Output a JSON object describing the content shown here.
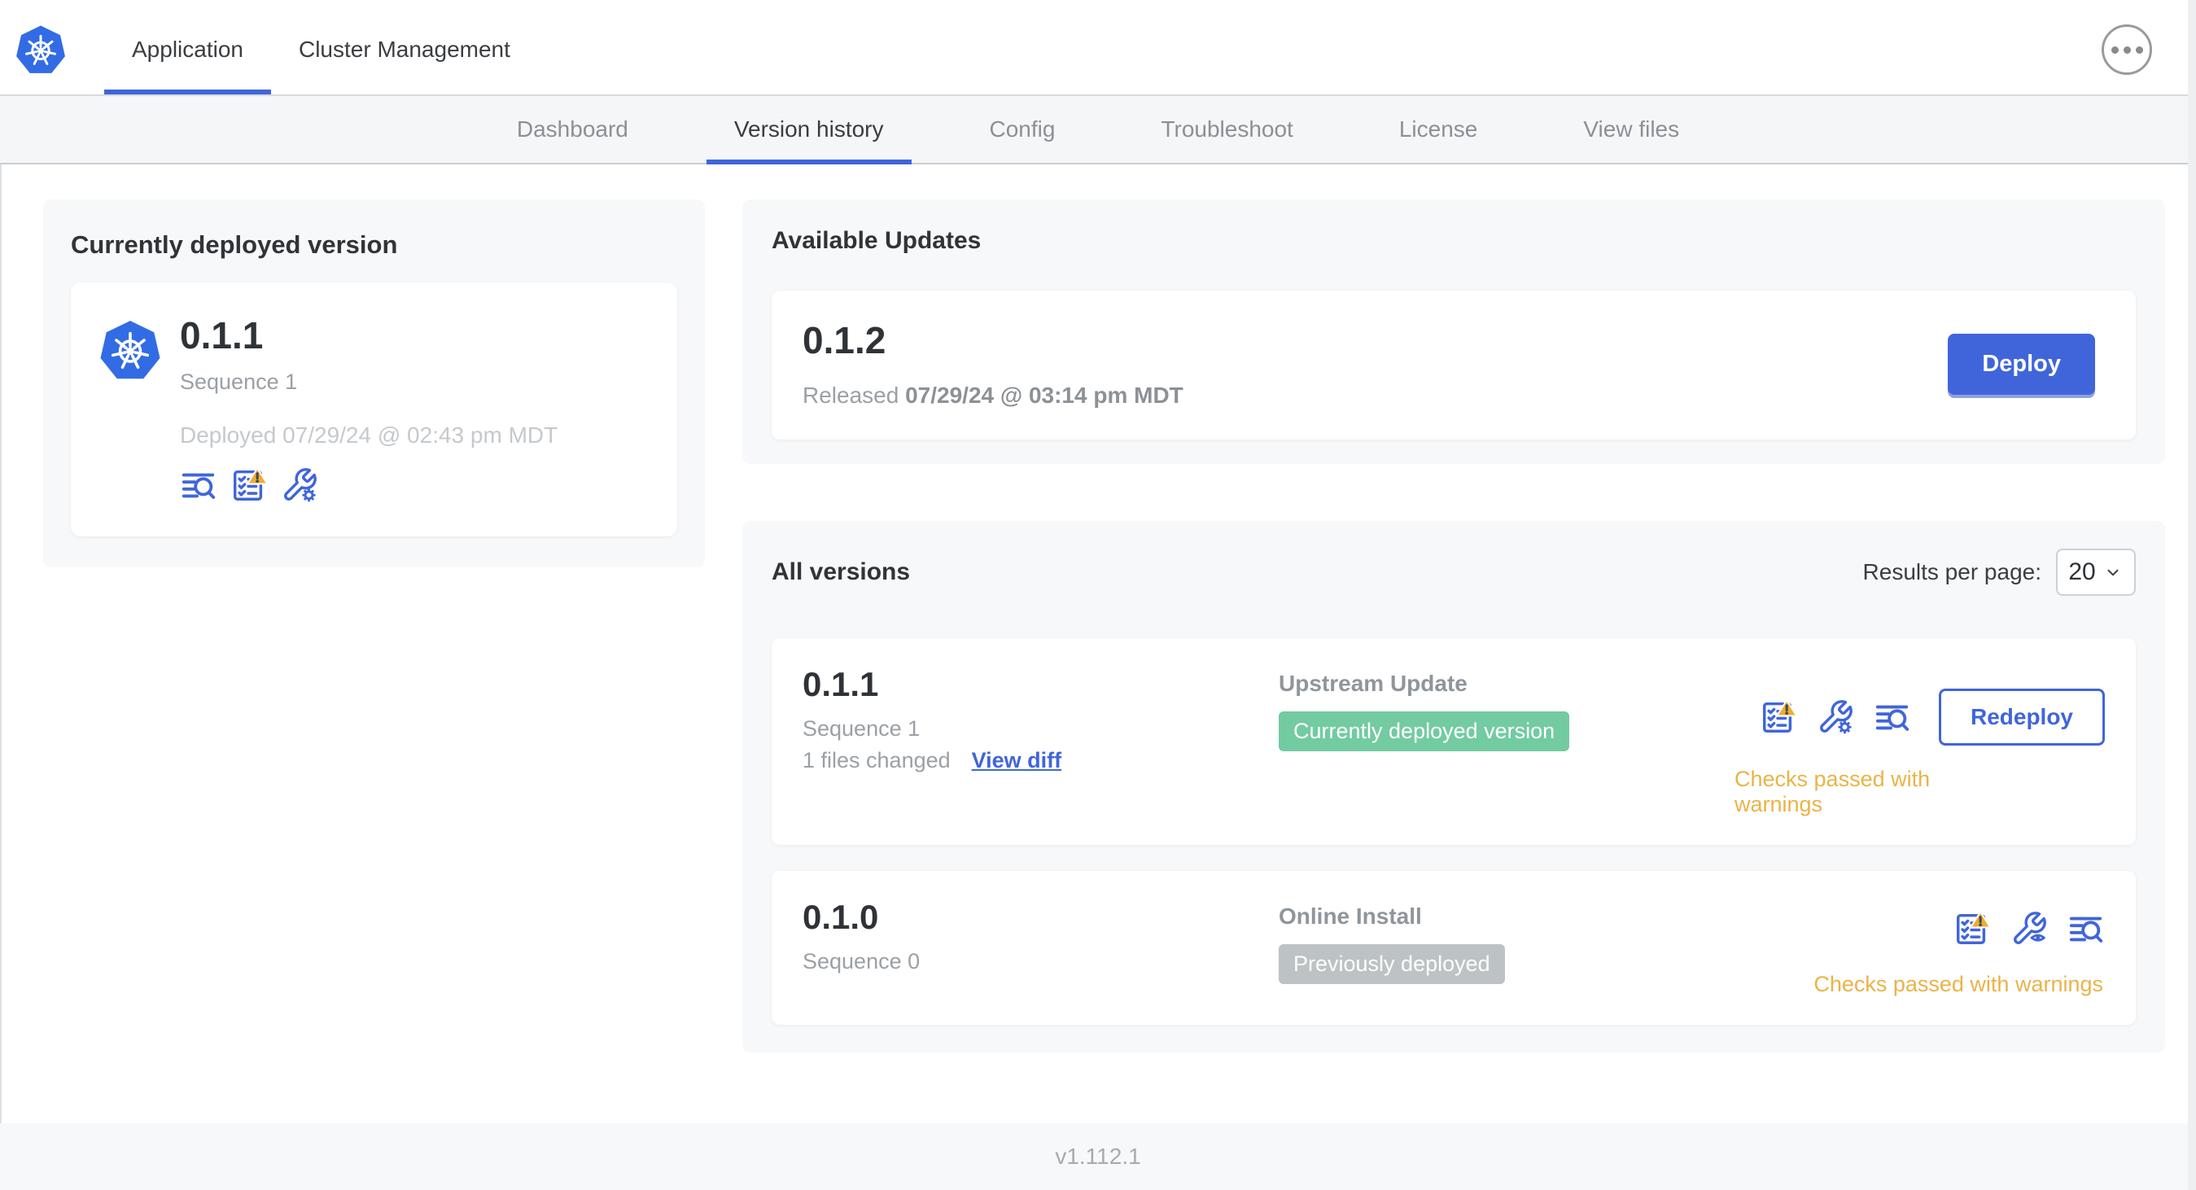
{
  "header": {
    "logo_icon": "kubernetes-logo",
    "tabs": [
      {
        "label": "Application",
        "active": true
      },
      {
        "label": "Cluster Management",
        "active": false
      }
    ],
    "menu_icon": "ellipsis-icon"
  },
  "subnav": {
    "items": [
      {
        "label": "Dashboard",
        "active": false
      },
      {
        "label": "Version history",
        "active": true
      },
      {
        "label": "Config",
        "active": false
      },
      {
        "label": "Troubleshoot",
        "active": false
      },
      {
        "label": "License",
        "active": false
      },
      {
        "label": "View files",
        "active": false
      }
    ]
  },
  "current_version": {
    "title": "Currently deployed version",
    "logo_icon": "kubernetes-logo",
    "version": "0.1.1",
    "sequence": "Sequence 1",
    "deployed": "Deployed 07/29/24 @ 02:43 pm MDT",
    "icons": [
      "logs-icon",
      "preflight-checks-warning-icon",
      "config-edit-icon"
    ]
  },
  "available_updates": {
    "title": "Available Updates",
    "version": "0.1.2",
    "released_label": "Released",
    "released_date": "07/29/24 @ 03:14 pm MDT",
    "deploy_label": "Deploy"
  },
  "all_versions": {
    "title": "All versions",
    "results_label": "Results per page:",
    "results_value": "20",
    "rows": [
      {
        "version": "0.1.1",
        "sequence": "Sequence 1",
        "files_changed": "1 files changed",
        "view_diff_label": "View diff",
        "source": "Upstream Update",
        "badge": {
          "label": "Currently deployed version",
          "color": "#73CBA2"
        },
        "icons": [
          "preflight-checks-warning-icon",
          "config-edit-icon",
          "logs-icon"
        ],
        "action_label": "Redeploy",
        "status": "Checks passed with warnings",
        "status_color": "#EBB347"
      },
      {
        "version": "0.1.0",
        "sequence": "Sequence 0",
        "source": "Online Install",
        "badge": {
          "label": "Previously deployed",
          "color": "#BDC2C4"
        },
        "icons": [
          "preflight-checks-warning-icon",
          "config-view-icon",
          "logs-icon"
        ],
        "status": "Checks passed with warnings",
        "status_color": "#EBB347"
      }
    ]
  },
  "footer": {
    "app_version": "v1.112.1"
  },
  "colors": {
    "accent_blue": "#4065DB",
    "kubernetes_blue": "#326CE5",
    "panel_gray": "#F7F8F9",
    "subnav_gray": "#F5F6F8",
    "badge_green": "#73CBA2",
    "badge_gray": "#BDC2C4",
    "warning_yellow": "#EBB347",
    "warning_triangle": "#F0AC2F"
  }
}
